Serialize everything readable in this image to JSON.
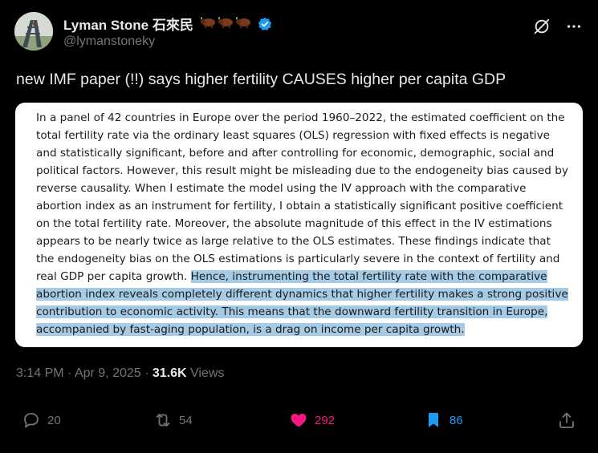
{
  "author": {
    "display_name": "Lyman Stone 石來民",
    "handle": "@lymanstoneky",
    "name_emojis": [
      "bison-emoji",
      "bison-emoji",
      "bison-emoji"
    ],
    "verified": true
  },
  "tweet": {
    "text": "new IMF paper (!!) says higher fertility CAUSES higher per capita GDP"
  },
  "quote_image": {
    "text_plain": "In a panel of 42 countries in Europe over the period 1960–2022, the estimated coefficient on the total fertility rate via the ordinary least squares (OLS) regression with fixed effects is negative and statistically significant, before and after controlling for economic, demographic, social and political factors. However, this result might be misleading due to the endogeneity bias caused by reverse causality. When I estimate the model using the IV approach with the comparative abortion index as an instrument for fertility, I obtain a statistically significant positive coefficient on the total fertility rate. Moreover, the absolute magnitude of this effect in the IV estimations appears to be nearly twice as large relative to the OLS estimates. These findings indicate that the endogeneity bias on the OLS estimations is particularly severe in the context of fertility and real GDP per capita growth. ",
    "text_highlighted": "Hence, instrumenting the total fertility rate with the comparative abortion index reveals completely different dynamics that higher fertility makes a strong positive contribution to economic activity. This means that the downward fertility transition in Europe, accompanied by fast-aging population, is a drag on income per capita growth.",
    "highlight_color": "#a6cbe6"
  },
  "meta": {
    "time": "3:14 PM",
    "sep1": " · ",
    "date": "Apr 9, 2025",
    "sep2": " · ",
    "views_count": "31.6K",
    "views_label": " Views"
  },
  "actions": {
    "replies": "20",
    "reposts": "54",
    "likes": "292",
    "bookmarks": "86"
  },
  "colors": {
    "background": "#000000",
    "text": "#e7e9ea",
    "secondary": "#71767b",
    "like": "#f91880",
    "bookmark": "#1d9bf0",
    "verified": "#1d9bf0"
  }
}
